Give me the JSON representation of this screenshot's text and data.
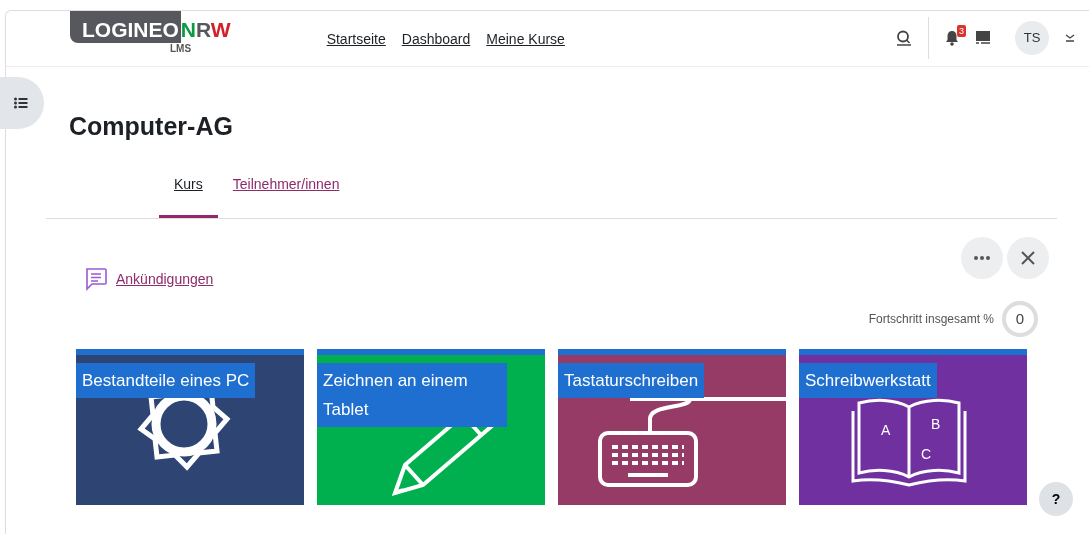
{
  "logo": {
    "word_1": "LOGINEO",
    "word_2": "NRW",
    "subtitle": "LMS"
  },
  "nav_links": [
    "Startseite",
    "Dashboard",
    "Meine Kurse"
  ],
  "notifications": {
    "count": "3"
  },
  "user": {
    "initials": "TS"
  },
  "course_title": "Computer-AG",
  "tabs": [
    {
      "label": "Kurs",
      "selected": true
    },
    {
      "label": "Teilnehmer/innen",
      "selected": false
    }
  ],
  "announcements_link": "Ankündigungen",
  "progress": {
    "label": "Fortschritt insgesamt %",
    "value": "0"
  },
  "tiles": [
    {
      "title": "Bestandteile eines PC",
      "kind": "gear",
      "color": "#2e4473"
    },
    {
      "title": "Zeichnen an einem Tablet",
      "kind": "pencil",
      "color": "#00b04f"
    },
    {
      "title": "Tastaturschreiben",
      "kind": "keyboard",
      "color": "#963b66"
    },
    {
      "title": "Schreibwerkstatt",
      "kind": "book",
      "color": "#7030a0",
      "letters": [
        "A",
        "B",
        "C"
      ]
    }
  ],
  "help": "?"
}
